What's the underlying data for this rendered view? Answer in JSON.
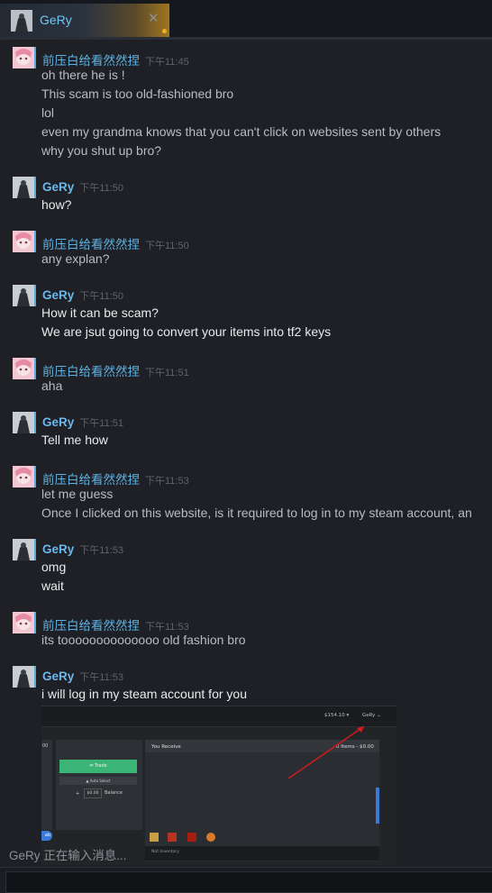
{
  "tab": {
    "name": "GeRy",
    "close_glyph": "✕"
  },
  "messages": [
    {
      "sender": "前压白给看然然捏",
      "side": "other",
      "time": "下午11:45",
      "lines": [
        "oh there he is !",
        "This scam is too old-fashioned bro",
        "lol",
        "even my grandma knows that you can't click on websites sent by others",
        "why you shut up bro?"
      ]
    },
    {
      "sender": "GeRy",
      "side": "me",
      "time": "下午11:50",
      "lines": [
        "how?"
      ]
    },
    {
      "sender": "前压白给看然然捏",
      "side": "other",
      "time": "下午11:50",
      "lines": [
        "any explan?"
      ]
    },
    {
      "sender": "GeRy",
      "side": "me",
      "time": "下午11:50",
      "lines": [
        "How it can be scam?",
        "We are jsut going to convert your items into tf2 keys"
      ]
    },
    {
      "sender": "前压白给看然然捏",
      "side": "other",
      "time": "下午11:51",
      "lines": [
        "aha"
      ]
    },
    {
      "sender": "GeRy",
      "side": "me",
      "time": "下午11:51",
      "lines": [
        "Tell me how"
      ]
    },
    {
      "sender": "前压白给看然然捏",
      "side": "other",
      "time": "下午11:53",
      "lines": [
        "let me guess",
        "Once I clicked on this website, is it required to log in to my steam account, an"
      ]
    },
    {
      "sender": "GeRy",
      "side": "me",
      "time": "下午11:53",
      "lines": [
        "omg",
        "wait"
      ]
    },
    {
      "sender": "前压白给看然然捏",
      "side": "other",
      "time": "下午11:53",
      "lines": [
        "its toooooooooooooo old fashion bro"
      ]
    },
    {
      "sender": "GeRy",
      "side": "me",
      "time": "下午11:53",
      "lines": [
        "i will log in my steam account for you"
      ]
    }
  ],
  "embedded_screenshot": {
    "balance": "$154.10 ▾",
    "user": "GeRy ⌄",
    "left_value": "00",
    "trade_button": "⇌ Trade",
    "auto_select": "▲ Auto Select",
    "plus": "+",
    "amount": "$0.00",
    "balance_label": "Balance",
    "receive_label": "You Receive",
    "receive_count": "0 Items - $0.00",
    "inventory_label": "Not Inventory",
    "pill_text": "ab"
  },
  "typing_status": "GeRy 正在输入消息...",
  "colors": {
    "accent": "#6ab8ee",
    "background": "#1e2025",
    "trade": "#3bb575",
    "arrow": "#d11a1a"
  }
}
